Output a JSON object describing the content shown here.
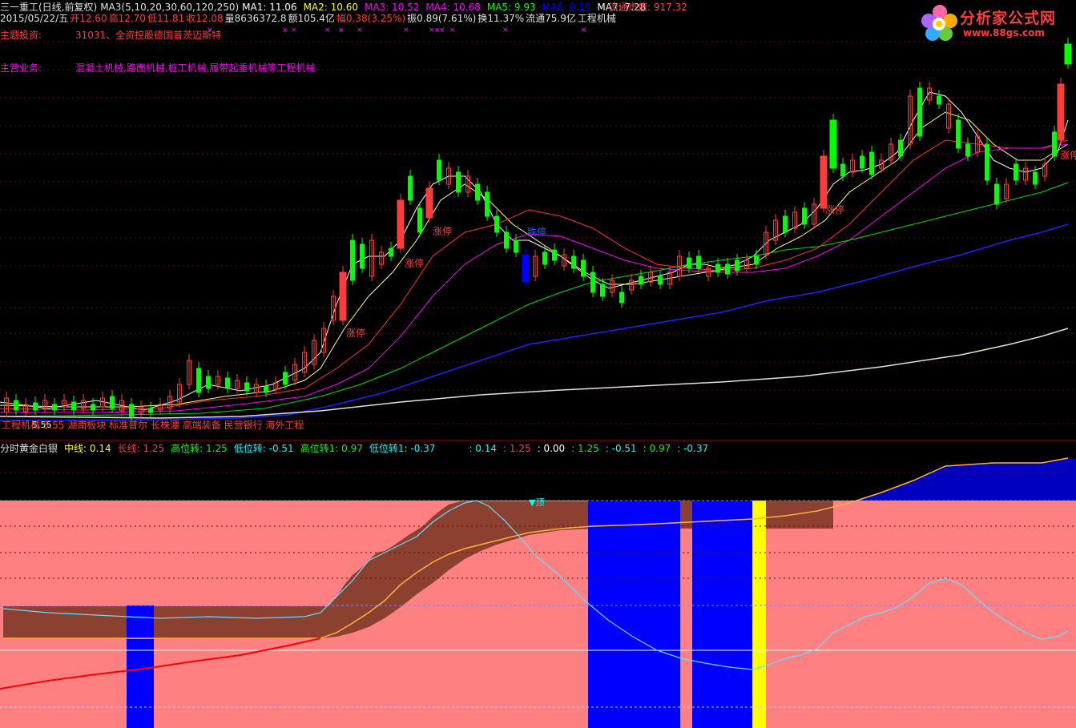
{
  "header": {
    "title": "三一重工(日线,前复权)",
    "ma_def": "MA3(5,10,20,30,60,120,250)",
    "ma": [
      {
        "label": "MA1: 11.06",
        "color": "#ffffff"
      },
      {
        "label": "MA2: 10.60",
        "color": "#ffff00"
      },
      {
        "label": "MA3: 10.52",
        "color": "#ff00ff"
      },
      {
        "label": "MA4: 10.68",
        "color": "#ff00ff"
      },
      {
        "label": "MA5: 9.93",
        "color": "#00ff00"
      },
      {
        "label": "MA6: 9.19",
        "color": "#0000ff"
      },
      {
        "label": "MA7: 7.28",
        "color": "#ffffff"
      }
    ],
    "market_cap": "流通市值: 917.32"
  },
  "quote": {
    "date": "2015/05/22/五",
    "open": "开12.60",
    "high": "高12.70",
    "low": "低11.81",
    "close": "收12.08",
    "volume": "量8636372.8",
    "amount": "额105.4亿",
    "change": "幅0.38(3.25%)",
    "amplitude": "振0.89(7.61%)",
    "turnover": "换11.37%",
    "float": "流通75.9亿",
    "sector": "工程机械"
  },
  "info": {
    "theme_label": "主题投资:",
    "theme_value": "31031、全资控股德国普茨迈斯特",
    "business_label": "主营业务:",
    "business_value": "混凝土机械,路面机械,桩工机械,履带起重机械等工程机械",
    "bottom_tags": "工程机械 5.55 湖南板块 标准普尔 长株潭 高端装备 民营银行 海外工程"
  },
  "annotations": {
    "limit_up": "涨停",
    "limit_down": "跌停",
    "top": "▼顶",
    "price_low": "5.55"
  },
  "indicator": {
    "name": "分时黄金白银",
    "items": [
      {
        "label": "中线: 0.14",
        "color": "#ffff00"
      },
      {
        "label": "长线: 1.25",
        "color": "#ff3c3c"
      },
      {
        "label": "高位转: 1.25",
        "color": "#00ff00"
      },
      {
        "label": "低位转: -0.51",
        "color": "#00ffff"
      },
      {
        "label": "高位转1: 0.97",
        "color": "#00ff00"
      },
      {
        "label": "低位转1: -0.37",
        "color": "#00ffff"
      }
    ],
    "extras": [
      {
        "label": ": 0.14",
        "color": "#00ffff"
      },
      {
        "label": ": 1.25",
        "color": "#ff3c3c"
      },
      {
        "label": ": 0.00",
        "color": "#ffffff"
      },
      {
        "label": ": 1.25",
        "color": "#00ff00"
      },
      {
        "label": ": -0.51",
        "color": "#00ffff"
      },
      {
        "label": ": 0.97",
        "color": "#00ff00"
      },
      {
        "label": ": -0.37",
        "color": "#00ffff"
      }
    ]
  },
  "logo": {
    "title": "分析家公式网",
    "url": "www.88gs.com"
  },
  "colors": {
    "up": "#ff3c3c",
    "down": "#00ff00",
    "bg": "#000000",
    "pink": "#ff8080",
    "brown": "#8b4030",
    "blue": "#0000ff",
    "yellow": "#ffff00"
  }
}
